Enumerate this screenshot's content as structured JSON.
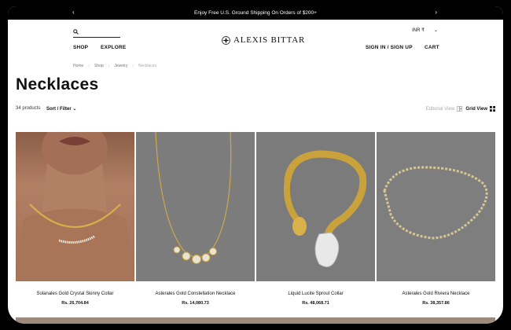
{
  "promo": {
    "text": "Enjoy Free U.S. Ground Shipping On Orders of $200+"
  },
  "nav": {
    "shop": "SHOP",
    "explore": "EXPLORE",
    "signin": "SIGN IN / SIGN UP",
    "cart": "CART"
  },
  "logo": {
    "text": "ALEXIS BITTAR"
  },
  "currency": {
    "value": "INR ₹"
  },
  "breadcrumbs": [
    "Home",
    "Shop",
    "Jewelry",
    "Necklaces"
  ],
  "page": {
    "title": "Necklaces",
    "count": "34 products",
    "sort_label": "Sort / Filter",
    "editorial_view": "Editorial View",
    "grid_view": "Grid View"
  },
  "products": [
    {
      "name": "Solanales Gold Crystal Skinny Collar",
      "price": "Rs. 26,704.84"
    },
    {
      "name": "Asterales Gold Constellation Necklace",
      "price": "Rs. 14,080.73"
    },
    {
      "name": "Liquid Lucite Sprout Collar",
      "price": "Rs. 48,068.71"
    },
    {
      "name": "Asterales Gold Riviera Necklace",
      "price": "Rs. 38,357.86"
    }
  ],
  "colors": {
    "accent": "#000000",
    "gold": "#c9a23c",
    "skin": "#a0725a",
    "backdrop": "#7b7b7b"
  }
}
